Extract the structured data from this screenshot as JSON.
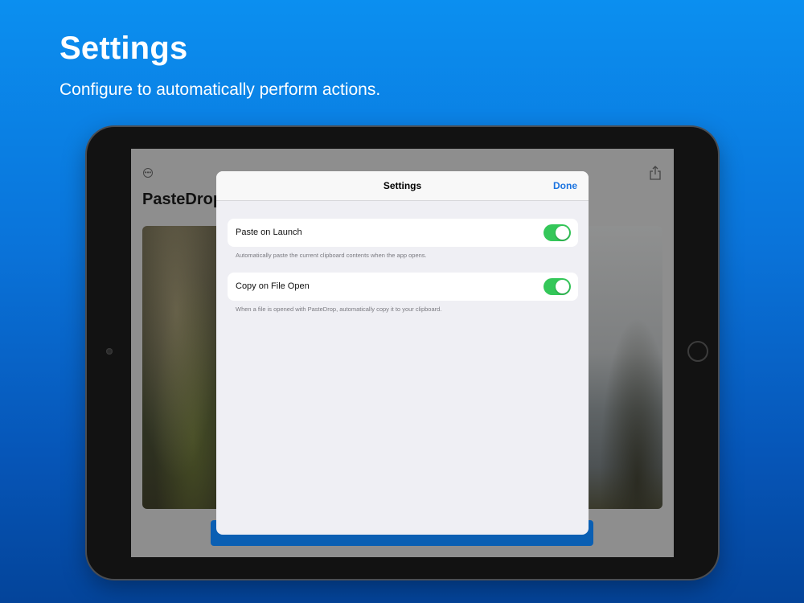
{
  "hero": {
    "title": "Settings",
    "subtitle": "Configure to automatically perform actions."
  },
  "background_app": {
    "title": "PasteDrop",
    "more_icon": "ellipsis-circle-icon",
    "share_icon": "share-icon"
  },
  "modal": {
    "title": "Settings",
    "done_label": "Done",
    "settings": [
      {
        "label": "Paste on Launch",
        "enabled": true,
        "footnote": "Automatically paste the current clipboard contents when the app opens."
      },
      {
        "label": "Copy on File Open",
        "enabled": true,
        "footnote": "When a file is opened with PasteDrop, automatically copy it to your clipboard."
      }
    ]
  },
  "colors": {
    "accent": "#1a73e0",
    "toggle_on": "#34c759",
    "background_top": "#0b8ff0",
    "background_bottom": "#04449a"
  }
}
